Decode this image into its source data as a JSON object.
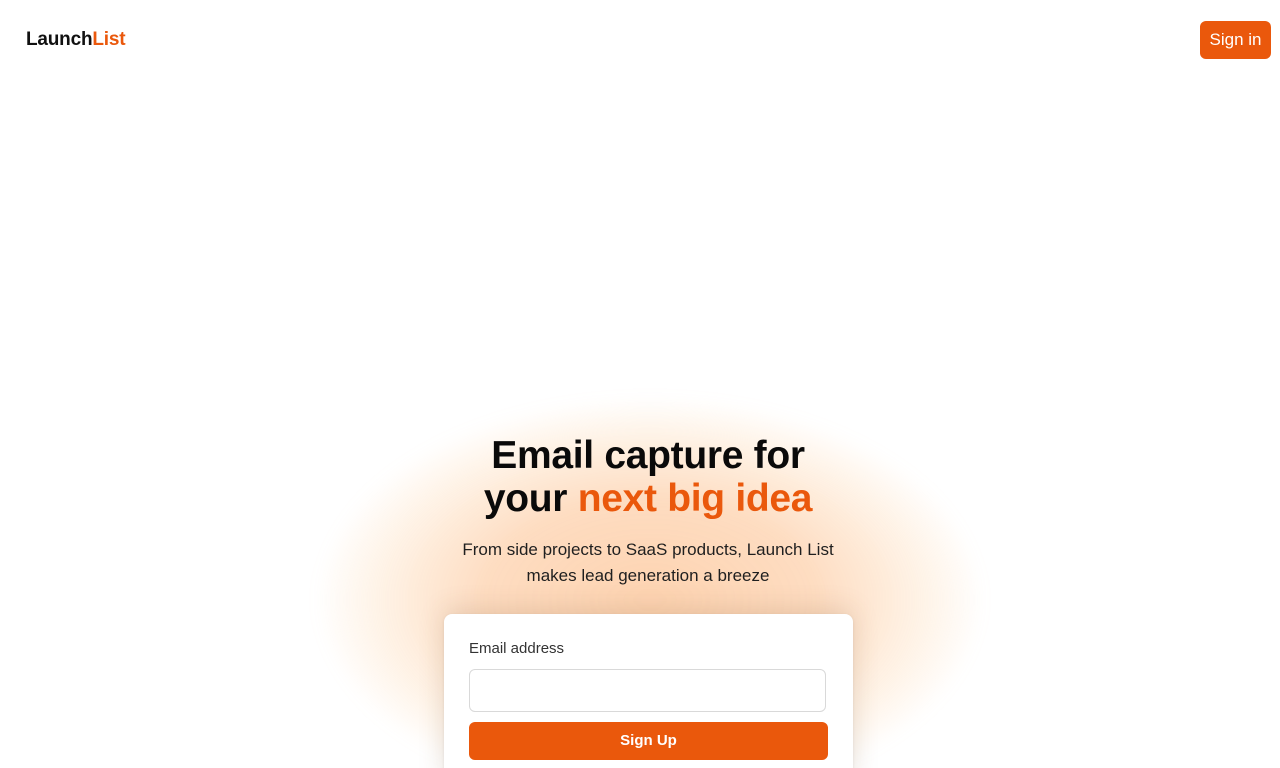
{
  "header": {
    "logo_main": "Launch",
    "logo_accent": "List",
    "signin_label": "Sign in"
  },
  "hero": {
    "title_line1": "Email capture for",
    "title_line2_plain": "your ",
    "title_line2_accent": "next big idea",
    "subtitle_line1": "From side projects to SaaS products, Launch List",
    "subtitle_line2": "makes lead generation a breeze"
  },
  "signup_form": {
    "email_label": "Email address",
    "email_value": "",
    "email_placeholder": "",
    "submit_label": "Sign Up"
  },
  "colors": {
    "accent": "#ea580c",
    "text": "#0a0a0a",
    "background": "#ffffff"
  }
}
